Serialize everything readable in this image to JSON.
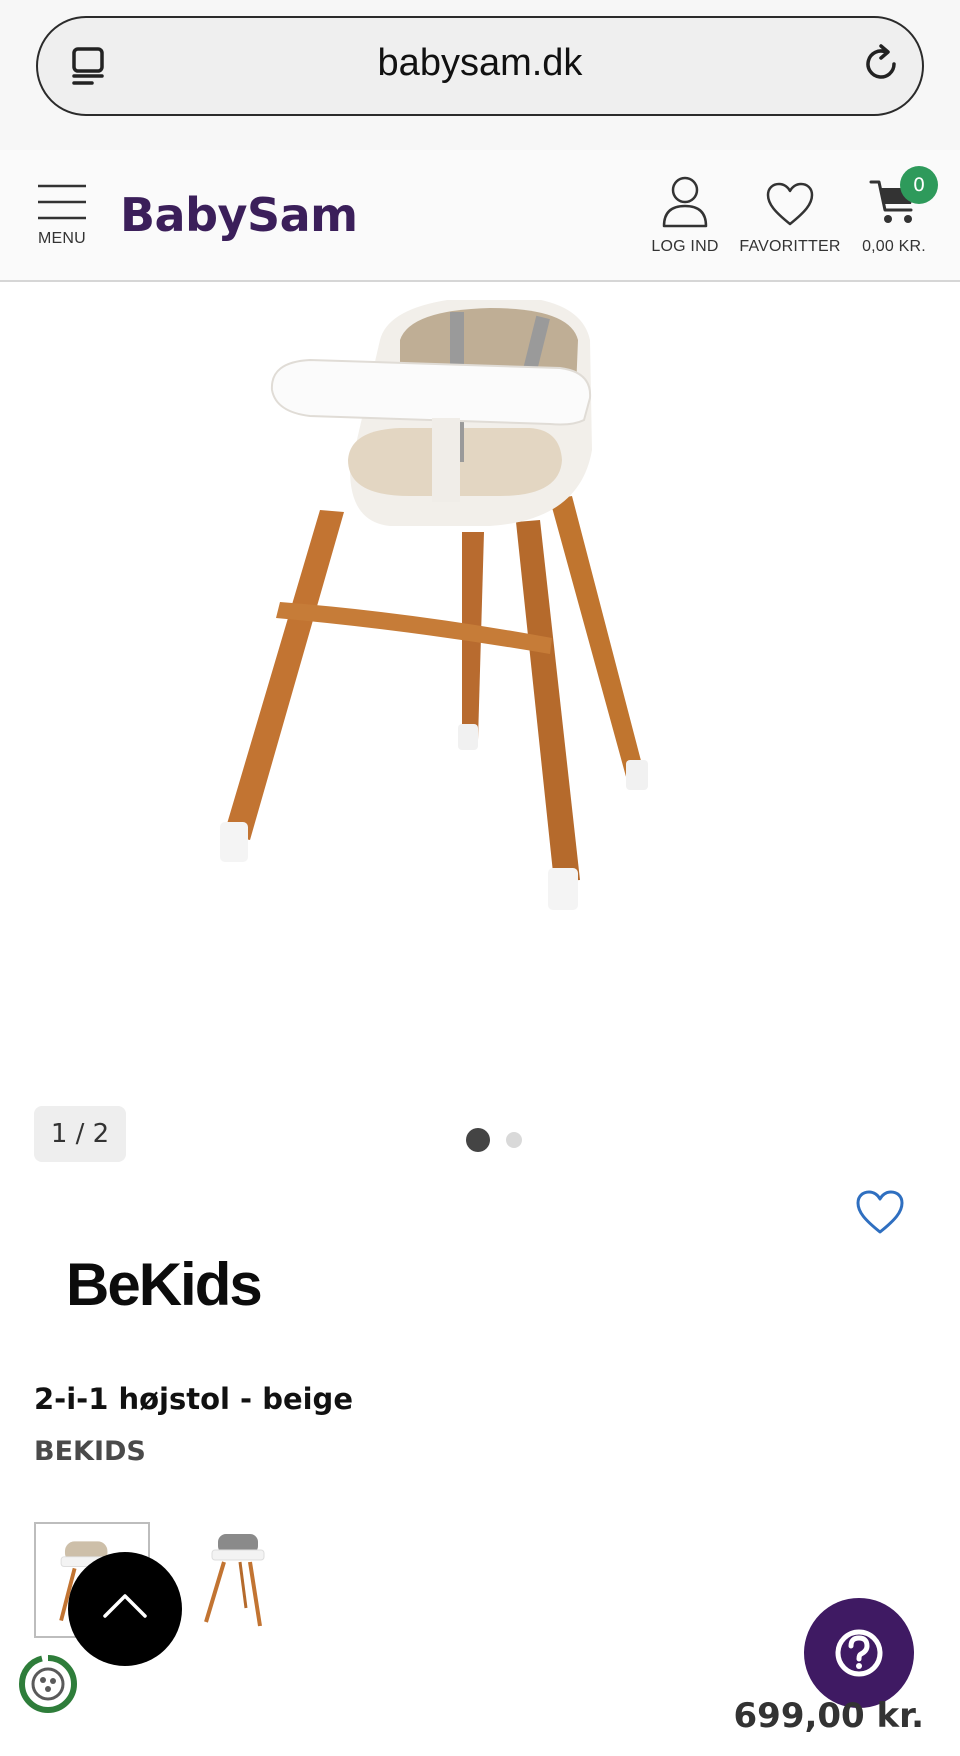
{
  "browser": {
    "domain": "babysam.dk"
  },
  "header": {
    "logo": "BabySam",
    "menu_label": "MENU",
    "login_label": "LOG IND",
    "favorites_label": "FAVORITTER",
    "cart_total": "0,00 KR.",
    "cart_count": "0"
  },
  "gallery": {
    "counter": "1 / 2",
    "active_index": 0,
    "total": 2
  },
  "product": {
    "brand_logo": "BeKids",
    "title": "2-i-1 højstol - beige",
    "brand": "BEKIDS",
    "price": "699,00 kr."
  },
  "colors": {
    "brand_purple": "#3b1f5a",
    "cart_badge_green": "#2e9a5b",
    "help_button": "#3f1a63",
    "wishlist_heart": "#2f6fc0"
  },
  "icons": [
    "tabs-icon",
    "reload-icon",
    "hamburger-icon",
    "user-icon",
    "heart-icon",
    "cart-icon",
    "chevron-up-icon",
    "question-icon",
    "eco-badge-icon"
  ]
}
